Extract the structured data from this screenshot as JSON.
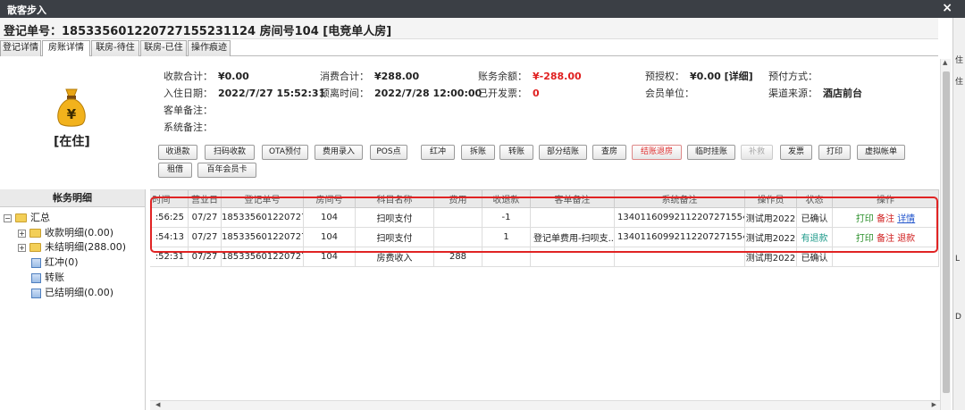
{
  "window": {
    "title": "散客步入",
    "close": "×"
  },
  "header": {
    "text": "登记单号：18533560122072715523112​4 房间号104 [电竞单人房]"
  },
  "tabs": [
    "登记详情",
    "房账详情",
    "联房-待住",
    "联房-已住",
    "操作痕迹"
  ],
  "status": "[在住]",
  "info": {
    "r1": [
      {
        "label": "收款合计：",
        "value": "¥0.00"
      },
      {
        "label": "消费合计：",
        "value": "¥288.00"
      },
      {
        "label": "账务余额：",
        "value": "¥-288.00"
      },
      {
        "label": "预授权：",
        "value": "¥0.00 [详细]"
      },
      {
        "label": "预付方式：",
        "value": ""
      }
    ],
    "r2": [
      {
        "label": "入住日期：",
        "value": "2022/7/27 15:52:31"
      },
      {
        "label": "预离时间：",
        "value": "2022/7/28 12:00:00"
      },
      {
        "label": "已开发票：",
        "value": "0"
      },
      {
        "label": "会员单位：",
        "value": ""
      },
      {
        "label": "渠道来源：",
        "value": "酒店前台"
      }
    ],
    "r3": {
      "label": "客单备注：",
      "value": ""
    },
    "r4": {
      "label": "系统备注：",
      "value": ""
    }
  },
  "buttons": [
    "收退款",
    "扫码收款",
    "OTA预付",
    "费用录入",
    "POS点",
    "红冲",
    "拆账",
    "转账",
    "部分结账",
    "查房",
    "结账退房",
    "临时挂账",
    "补救",
    "发票",
    "打印",
    "虚拟帐单",
    "租借",
    "百年会员卡"
  ],
  "left_panel": {
    "title": "帐务明细",
    "tree": [
      "汇总",
      "收款明细(0.00)",
      "未结明细(288.00)",
      "红冲(0)",
      "转账",
      "已结明细(0.00)"
    ]
  },
  "table": {
    "headers": [
      "时间",
      "营业日",
      "登记单号",
      "房间号",
      "科目名称",
      "费用",
      "收退款",
      "客单备注",
      "系统备注",
      "操作员",
      "状态",
      "操作"
    ],
    "rows": [
      {
        "time": ":56:25",
        "day": "07/27",
        "reg": "185335601220727...",
        "room": "104",
        "item": "扫呗支付",
        "fee": "",
        "refund": "-1",
        "note": "",
        "sys": "134011609921122072715541​0...",
        "op": "测试用2022",
        "state": "已确认",
        "a1": "打印",
        "a2": "备注",
        "a3": "详情"
      },
      {
        "time": ":54:13",
        "day": "07/27",
        "reg": "185335601220727...",
        "room": "104",
        "item": "扫呗支付",
        "fee": "",
        "refund": "1",
        "note": "登记单费用-扫呗支...",
        "sys": "134011609921122072715541​0...",
        "op": "测试用2022",
        "state": "有退款",
        "a1": "打印",
        "a2": "备注",
        "a3": "退款"
      },
      {
        "time": ":52:31",
        "day": "07/27",
        "reg": "185335601220727...",
        "room": "104",
        "item": "房费收入",
        "fee": "288",
        "refund": "",
        "note": "",
        "sys": "",
        "op": "测试用2022",
        "state": "已确认",
        "a1": "",
        "a2": "",
        "a3": ""
      }
    ]
  },
  "right_strip": [
    "住",
    "住",
    "L",
    "D"
  ],
  "colors": {
    "titlebar": "#3b3f45",
    "highlight": "#e02424",
    "red": "#e02020"
  },
  "icons": {
    "moneybag": "moneybag-icon"
  }
}
